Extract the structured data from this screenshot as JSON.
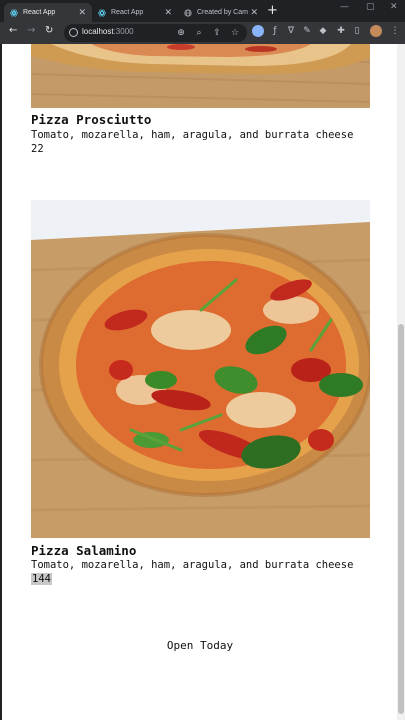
{
  "browser": {
    "tabs": [
      {
        "title": "React App",
        "active": true
      },
      {
        "title": "React App",
        "active": false
      },
      {
        "title": "Created by Cam",
        "active": false
      }
    ],
    "url_host": "localhost",
    "url_port": ":3000",
    "colors": {
      "chrome_dark": "#202124",
      "chrome_toolbar": "#35363a",
      "react_blue": "#61dafb"
    }
  },
  "menu": [
    {
      "name": "Pizza Prosciutto",
      "ingredients": "Tomato, mozarella, ham, aragula, and burrata cheese",
      "price": "22",
      "image_icon": "pizza-prosciutto-photo"
    },
    {
      "name": "Pizza Salamino",
      "ingredients": "Tomato, mozarella, ham, aragula, and burrata cheese",
      "price": "144",
      "image_icon": "pizza-salamino-photo"
    }
  ],
  "footer": {
    "status": "Open Today"
  }
}
